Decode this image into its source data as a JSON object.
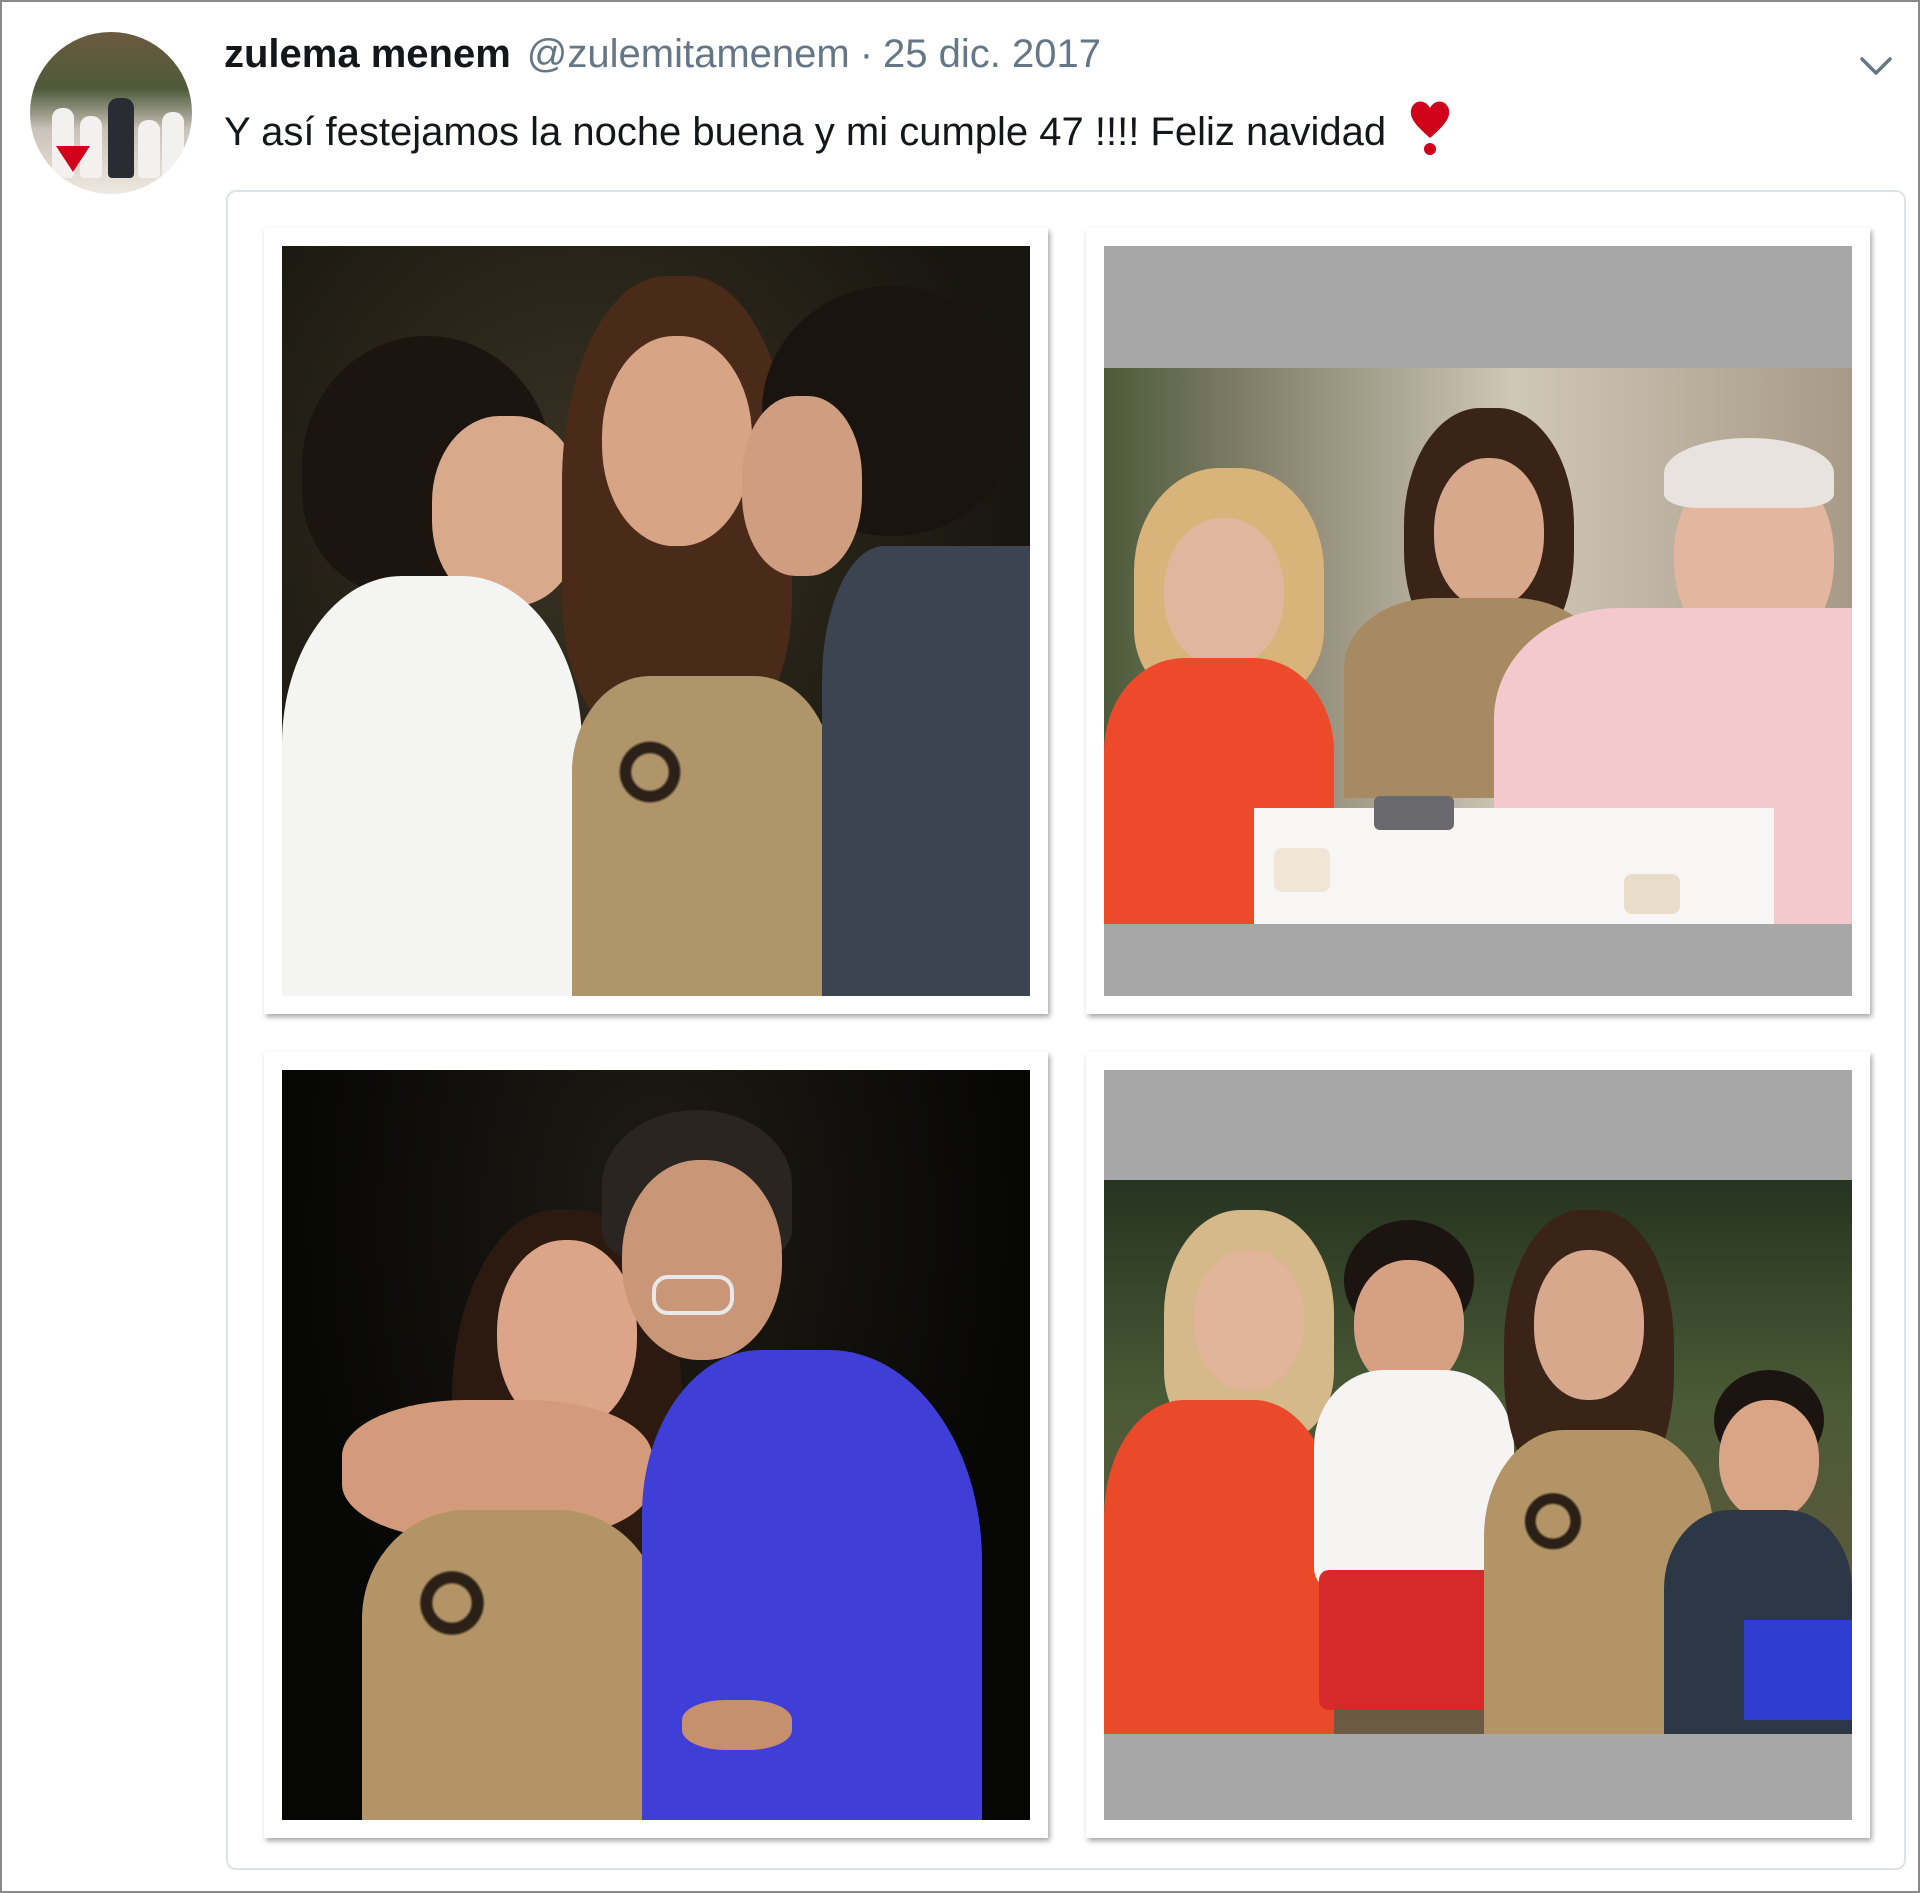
{
  "tweet": {
    "display_name": "zulema menem",
    "handle": "@zulemitamenem",
    "separator": "·",
    "date": "25 dic. 2017",
    "text": "Y así festejamos la noche buena y mi cumple 47 !!!! Feliz navidad"
  },
  "icons": {
    "menu": "chevron-down-icon",
    "emoji": "heavy-heart-exclamation-icon"
  },
  "colors": {
    "name": "#14171a",
    "secondary_text": "#657786",
    "heart": "#d0021b",
    "card_border": "#dde3e7",
    "photo_padding_gray": "#a7a7a7"
  },
  "media": {
    "photo_count": 4
  }
}
